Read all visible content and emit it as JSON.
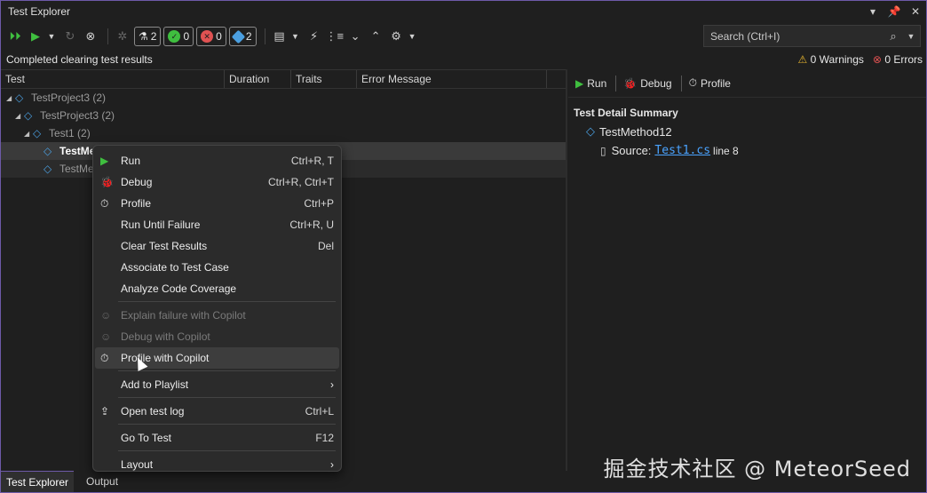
{
  "window": {
    "title": "Test Explorer"
  },
  "toolbar": {
    "counts": {
      "total": "2",
      "passed": "0",
      "failed": "0",
      "not_run": "2"
    },
    "search_placeholder": "Search (Ctrl+I)"
  },
  "status": {
    "message": "Completed clearing test results",
    "warnings": "0 Warnings",
    "errors": "0 Errors"
  },
  "grid": {
    "columns": [
      "Test",
      "Duration",
      "Traits",
      "Error Message"
    ],
    "rows": [
      {
        "label": "TestProject3",
        "count": "(2)"
      },
      {
        "label": "TestProject3",
        "count": "(2)"
      },
      {
        "label": "Test1",
        "count": "(2)"
      },
      {
        "label": "TestMe"
      },
      {
        "label": "TestMe"
      }
    ]
  },
  "detail": {
    "buttons": {
      "run": "Run",
      "debug": "Debug",
      "profile": "Profile"
    },
    "summary_title": "Test Detail Summary",
    "method": "TestMethod12",
    "source_label": "Source:",
    "source_file": "Test1.cs",
    "source_line": "line 8"
  },
  "context_menu": {
    "items": [
      {
        "label": "Run",
        "shortcut": "Ctrl+R, T"
      },
      {
        "label": "Debug",
        "shortcut": "Ctrl+R, Ctrl+T"
      },
      {
        "label": "Profile",
        "shortcut": "Ctrl+P"
      },
      {
        "label": "Run Until Failure",
        "shortcut": "Ctrl+R, U"
      },
      {
        "label": "Clear Test Results",
        "shortcut": "Del"
      },
      {
        "label": "Associate to Test Case",
        "shortcut": ""
      },
      {
        "label": "Analyze Code Coverage",
        "shortcut": ""
      },
      {
        "label": "Explain failure with Copilot",
        "shortcut": ""
      },
      {
        "label": "Debug with Copilot",
        "shortcut": ""
      },
      {
        "label": "Profile with Copilot",
        "shortcut": ""
      },
      {
        "label": "Add to Playlist",
        "shortcut": ""
      },
      {
        "label": "Open test log",
        "shortcut": "Ctrl+L"
      },
      {
        "label": "Go To Test",
        "shortcut": "F12"
      },
      {
        "label": "Layout",
        "shortcut": ""
      }
    ]
  },
  "tabs": [
    "Test Explorer",
    "Output"
  ],
  "watermark": "掘金技术社区 @ MeteorSeed",
  "colors": {
    "accent": "#6d5aa8",
    "link": "#4aa3ff",
    "run_green": "#3fbf3f"
  }
}
